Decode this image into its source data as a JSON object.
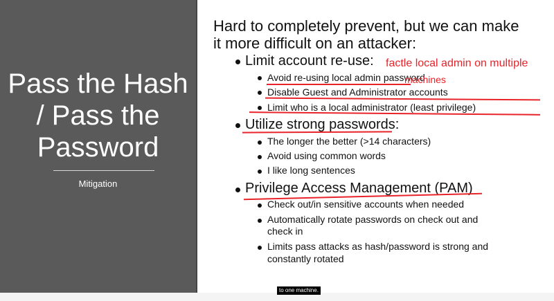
{
  "slide": {
    "title_lines": [
      "Pass the Hash",
      "/ Pass the",
      "Password"
    ],
    "subtitle": "Mitigation",
    "heading_lines": [
      "Hard to completely prevent, but we can make",
      "it more difficult on an attacker:"
    ],
    "sections": [
      {
        "label": "Limit account re-use:",
        "items": [
          "Avoid re-using local admin password",
          "Disable Guest and Administrator accounts",
          "Limit who is a local administrator (least privilege)"
        ]
      },
      {
        "label": "Utilize strong passwords:",
        "items": [
          "The longer the better (>14 characters)",
          "Avoid using common words",
          "I like long sentences"
        ]
      },
      {
        "label": "Privilege Access Management (PAM)",
        "items": [
          "Check out/in sensitive accounts when needed",
          "Automatically rotate passwords on check out and",
          "check in",
          "Limits pass attacks as hash/password is strong and",
          "constantly rotated"
        ]
      }
    ]
  },
  "annotation": {
    "line1": "factle local admin on multiple",
    "line2": "machines"
  },
  "caption": "to one machine.",
  "colors": {
    "panel": "#5a5a5a",
    "annotation": "#e8232a"
  }
}
